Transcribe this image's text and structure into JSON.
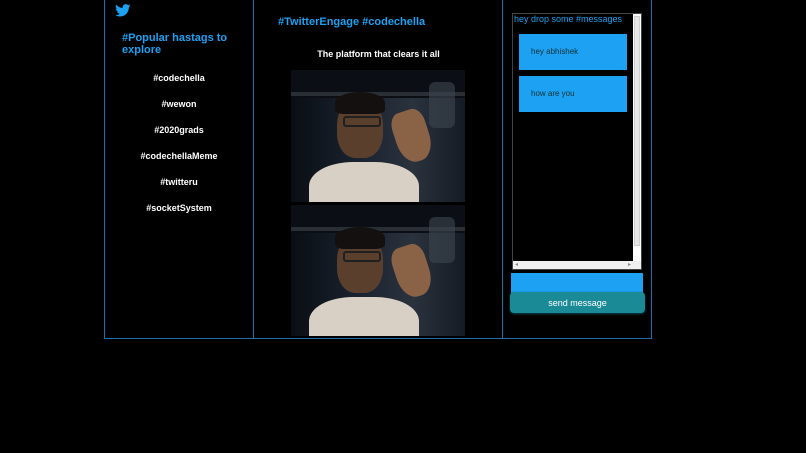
{
  "colors": {
    "accent": "#1da1f2",
    "border": "#1f6fa8",
    "button": "#1a8a96",
    "background": "#000000"
  },
  "sidebar": {
    "logo_icon": "twitter-bird-icon",
    "title": "#Popular hastags to explore",
    "hashtags": [
      "#codechella",
      "#wewon",
      "#2020grads",
      "#codechellaMeme",
      "#twitteru",
      "#socketSystem"
    ]
  },
  "main": {
    "title": "#TwitterEngage #codechella",
    "subtitle": "The platform that clears it all"
  },
  "chat": {
    "title": "hey drop some #messages",
    "messages": [
      "hey abhishek",
      "how are you"
    ],
    "input_value": "",
    "send_label": "send message"
  }
}
